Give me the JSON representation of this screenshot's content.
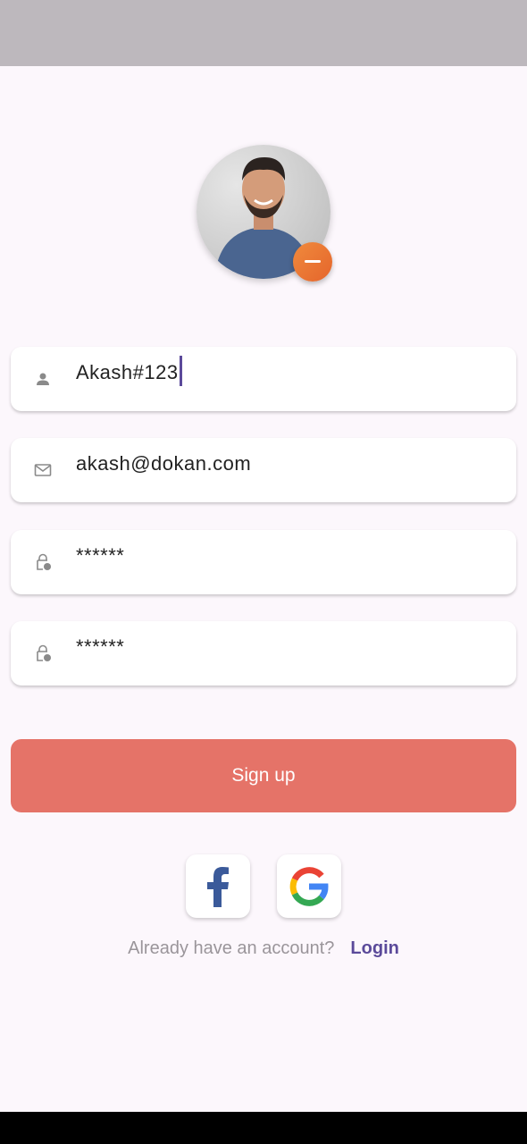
{
  "form": {
    "username": {
      "value": "Akash#123",
      "icon": "person-icon"
    },
    "email": {
      "value": "akash@dokan.com",
      "icon": "mail-icon"
    },
    "password": {
      "value": "******",
      "icon": "lock-clock-icon"
    },
    "confirm_password": {
      "value": "******",
      "icon": "lock-clock-icon"
    }
  },
  "signup_label": "Sign up",
  "social": [
    "facebook-icon",
    "google-icon"
  ],
  "footer": {
    "question": "Already have an account?",
    "login": "Login"
  },
  "colors": {
    "primary": "#e57368",
    "accent": "#5b4a9a",
    "badge": "#ec7634"
  }
}
